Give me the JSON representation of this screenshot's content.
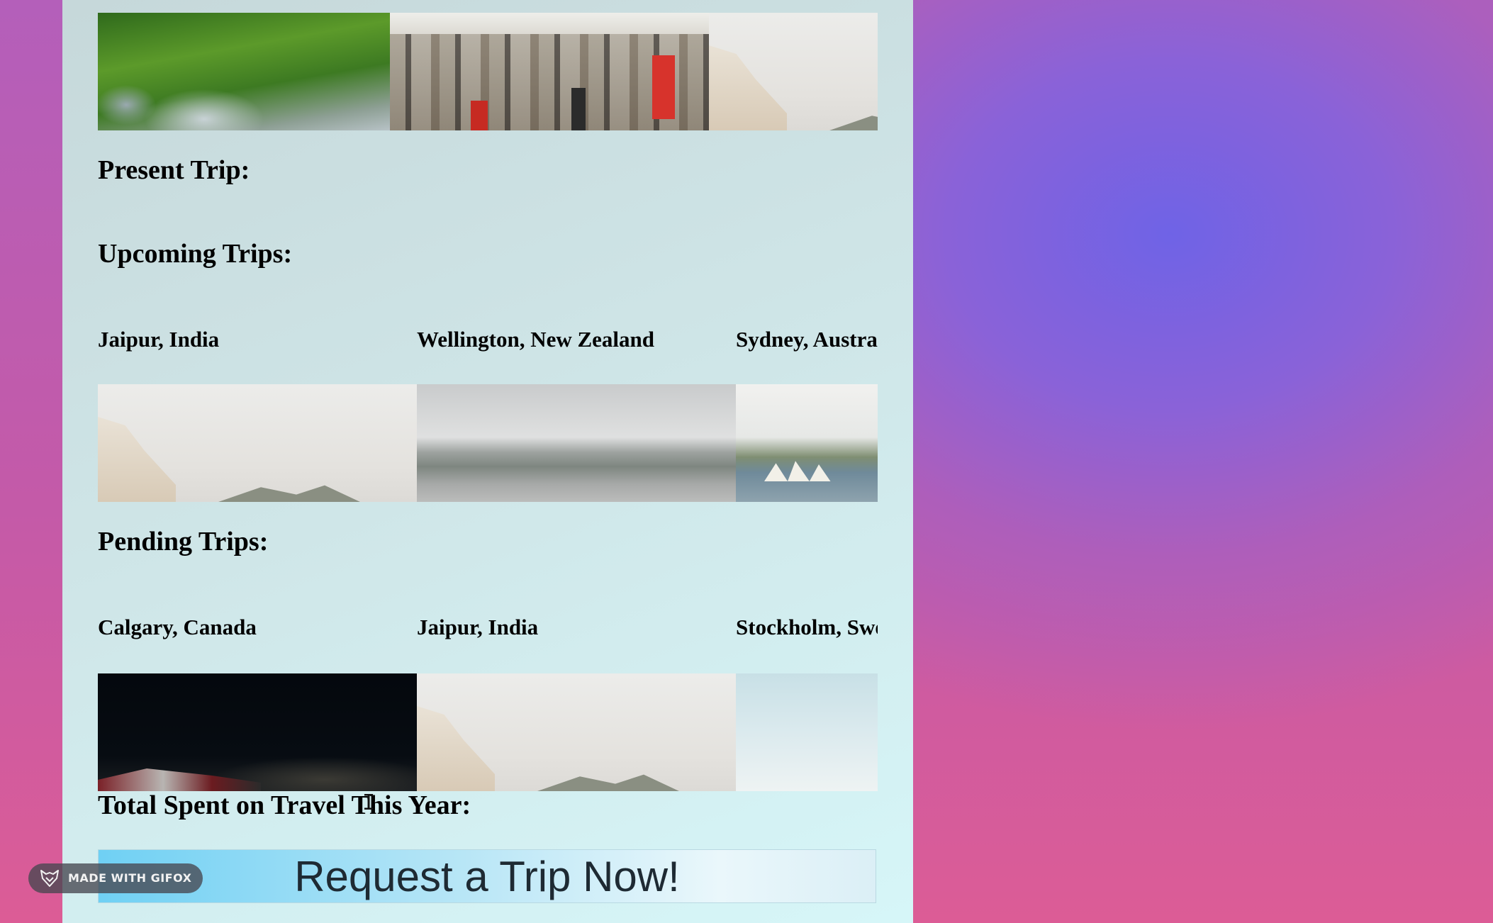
{
  "sections": {
    "present_heading": "Present Trip:",
    "upcoming_heading": "Upcoming Trips:",
    "pending_heading": "Pending Trips:",
    "total_heading": "Total Spent on Travel This Year:"
  },
  "upcoming": [
    {
      "name": "Jaipur, India",
      "image": "jaipur-palace"
    },
    {
      "name": "Wellington, New Zealand",
      "image": "wellington-cityscape"
    },
    {
      "name": "Sydney, Australia",
      "image": "sydney-opera-house"
    }
  ],
  "pending": [
    {
      "name": "Calgary, Canada",
      "image": "calgary-night"
    },
    {
      "name": "Jaipur, India",
      "image": "jaipur-palace"
    },
    {
      "name": "Stockholm, Sweden",
      "image": "stockholm-sky"
    }
  ],
  "top_images": [
    "forest-coast",
    "city-street",
    "jaipur-palace"
  ],
  "request_button": "Request a Trip Now!",
  "badge": {
    "label": "MADE WITH GIFOX",
    "icon": "fox-icon"
  }
}
